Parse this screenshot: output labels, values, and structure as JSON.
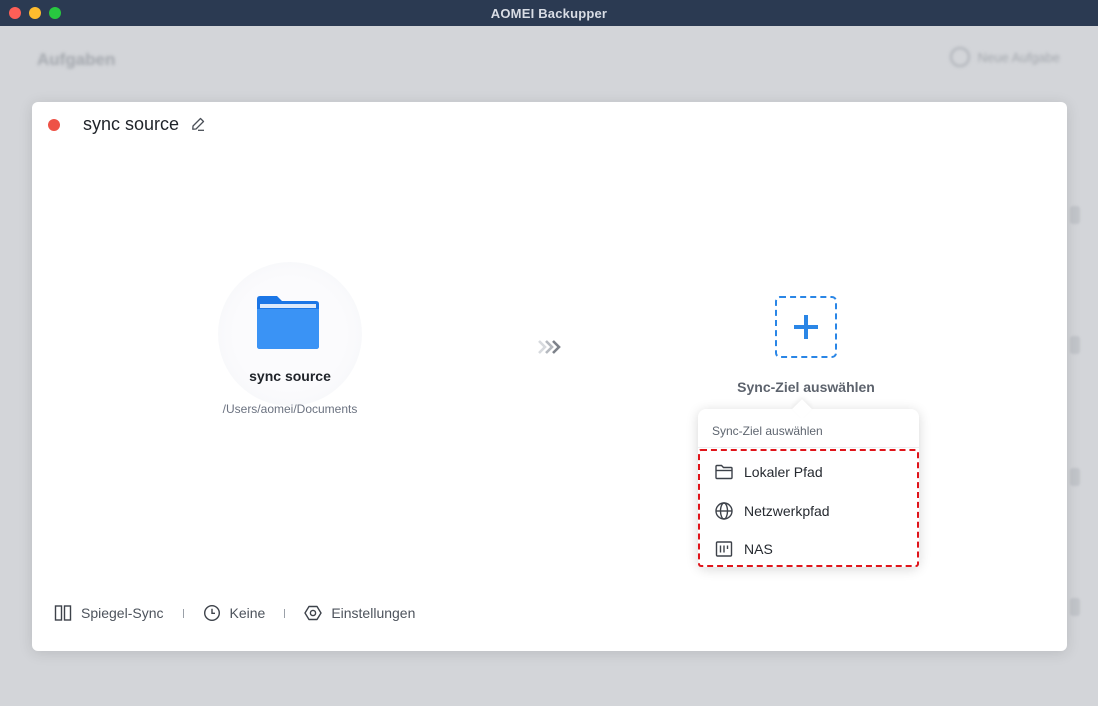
{
  "window": {
    "title": "AOMEI Backupper"
  },
  "background": {
    "heading": "Aufgaben",
    "new_task_label": "Neue Aufgabe"
  },
  "task": {
    "name": "sync source",
    "status_color": "#ee5246"
  },
  "source": {
    "name": "sync source",
    "path": "/Users/aomei/Documents",
    "icon": "folder-icon"
  },
  "destination": {
    "label": "Sync-Ziel auswählen",
    "icon": "add-icon",
    "accent": "#2a86e6"
  },
  "popover": {
    "header": "Sync-Ziel auswählen",
    "items": [
      {
        "label": "Lokaler Pfad",
        "icon": "folder-outline-icon"
      },
      {
        "label": "Netzwerkpfad",
        "icon": "globe-icon"
      },
      {
        "label": "NAS",
        "icon": "nas-icon"
      }
    ],
    "highlight_color": "#e0141a"
  },
  "footer": {
    "mode_label": "Spiegel-Sync",
    "schedule_label": "Keine",
    "settings_label": "Einstellungen"
  }
}
